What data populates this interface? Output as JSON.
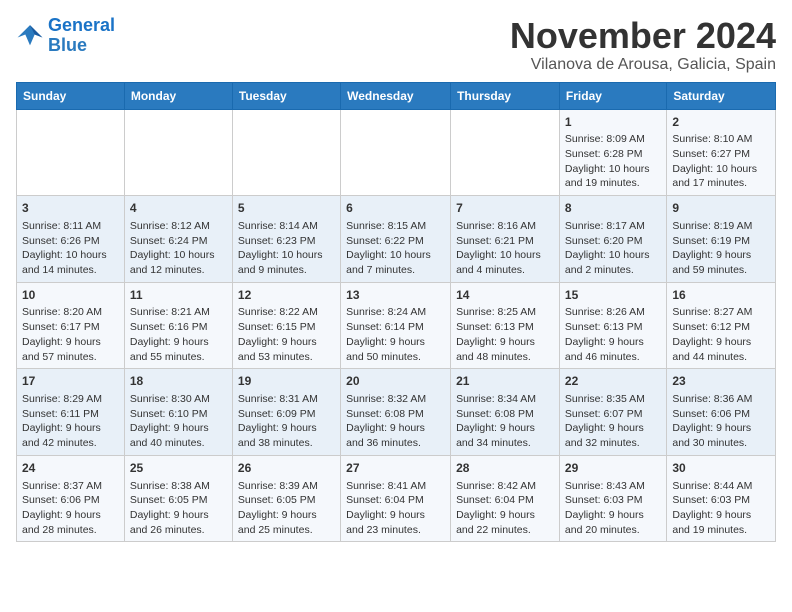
{
  "header": {
    "logo_line1": "General",
    "logo_line2": "Blue",
    "title": "November 2024",
    "subtitle": "Vilanova de Arousa, Galicia, Spain"
  },
  "weekdays": [
    "Sunday",
    "Monday",
    "Tuesday",
    "Wednesday",
    "Thursday",
    "Friday",
    "Saturday"
  ],
  "weeks": [
    [
      {
        "day": "",
        "text": ""
      },
      {
        "day": "",
        "text": ""
      },
      {
        "day": "",
        "text": ""
      },
      {
        "day": "",
        "text": ""
      },
      {
        "day": "",
        "text": ""
      },
      {
        "day": "1",
        "text": "Sunrise: 8:09 AM\nSunset: 6:28 PM\nDaylight: 10 hours and 19 minutes."
      },
      {
        "day": "2",
        "text": "Sunrise: 8:10 AM\nSunset: 6:27 PM\nDaylight: 10 hours and 17 minutes."
      }
    ],
    [
      {
        "day": "3",
        "text": "Sunrise: 8:11 AM\nSunset: 6:26 PM\nDaylight: 10 hours and 14 minutes."
      },
      {
        "day": "4",
        "text": "Sunrise: 8:12 AM\nSunset: 6:24 PM\nDaylight: 10 hours and 12 minutes."
      },
      {
        "day": "5",
        "text": "Sunrise: 8:14 AM\nSunset: 6:23 PM\nDaylight: 10 hours and 9 minutes."
      },
      {
        "day": "6",
        "text": "Sunrise: 8:15 AM\nSunset: 6:22 PM\nDaylight: 10 hours and 7 minutes."
      },
      {
        "day": "7",
        "text": "Sunrise: 8:16 AM\nSunset: 6:21 PM\nDaylight: 10 hours and 4 minutes."
      },
      {
        "day": "8",
        "text": "Sunrise: 8:17 AM\nSunset: 6:20 PM\nDaylight: 10 hours and 2 minutes."
      },
      {
        "day": "9",
        "text": "Sunrise: 8:19 AM\nSunset: 6:19 PM\nDaylight: 9 hours and 59 minutes."
      }
    ],
    [
      {
        "day": "10",
        "text": "Sunrise: 8:20 AM\nSunset: 6:17 PM\nDaylight: 9 hours and 57 minutes."
      },
      {
        "day": "11",
        "text": "Sunrise: 8:21 AM\nSunset: 6:16 PM\nDaylight: 9 hours and 55 minutes."
      },
      {
        "day": "12",
        "text": "Sunrise: 8:22 AM\nSunset: 6:15 PM\nDaylight: 9 hours and 53 minutes."
      },
      {
        "day": "13",
        "text": "Sunrise: 8:24 AM\nSunset: 6:14 PM\nDaylight: 9 hours and 50 minutes."
      },
      {
        "day": "14",
        "text": "Sunrise: 8:25 AM\nSunset: 6:13 PM\nDaylight: 9 hours and 48 minutes."
      },
      {
        "day": "15",
        "text": "Sunrise: 8:26 AM\nSunset: 6:13 PM\nDaylight: 9 hours and 46 minutes."
      },
      {
        "day": "16",
        "text": "Sunrise: 8:27 AM\nSunset: 6:12 PM\nDaylight: 9 hours and 44 minutes."
      }
    ],
    [
      {
        "day": "17",
        "text": "Sunrise: 8:29 AM\nSunset: 6:11 PM\nDaylight: 9 hours and 42 minutes."
      },
      {
        "day": "18",
        "text": "Sunrise: 8:30 AM\nSunset: 6:10 PM\nDaylight: 9 hours and 40 minutes."
      },
      {
        "day": "19",
        "text": "Sunrise: 8:31 AM\nSunset: 6:09 PM\nDaylight: 9 hours and 38 minutes."
      },
      {
        "day": "20",
        "text": "Sunrise: 8:32 AM\nSunset: 6:08 PM\nDaylight: 9 hours and 36 minutes."
      },
      {
        "day": "21",
        "text": "Sunrise: 8:34 AM\nSunset: 6:08 PM\nDaylight: 9 hours and 34 minutes."
      },
      {
        "day": "22",
        "text": "Sunrise: 8:35 AM\nSunset: 6:07 PM\nDaylight: 9 hours and 32 minutes."
      },
      {
        "day": "23",
        "text": "Sunrise: 8:36 AM\nSunset: 6:06 PM\nDaylight: 9 hours and 30 minutes."
      }
    ],
    [
      {
        "day": "24",
        "text": "Sunrise: 8:37 AM\nSunset: 6:06 PM\nDaylight: 9 hours and 28 minutes."
      },
      {
        "day": "25",
        "text": "Sunrise: 8:38 AM\nSunset: 6:05 PM\nDaylight: 9 hours and 26 minutes."
      },
      {
        "day": "26",
        "text": "Sunrise: 8:39 AM\nSunset: 6:05 PM\nDaylight: 9 hours and 25 minutes."
      },
      {
        "day": "27",
        "text": "Sunrise: 8:41 AM\nSunset: 6:04 PM\nDaylight: 9 hours and 23 minutes."
      },
      {
        "day": "28",
        "text": "Sunrise: 8:42 AM\nSunset: 6:04 PM\nDaylight: 9 hours and 22 minutes."
      },
      {
        "day": "29",
        "text": "Sunrise: 8:43 AM\nSunset: 6:03 PM\nDaylight: 9 hours and 20 minutes."
      },
      {
        "day": "30",
        "text": "Sunrise: 8:44 AM\nSunset: 6:03 PM\nDaylight: 9 hours and 19 minutes."
      }
    ]
  ]
}
